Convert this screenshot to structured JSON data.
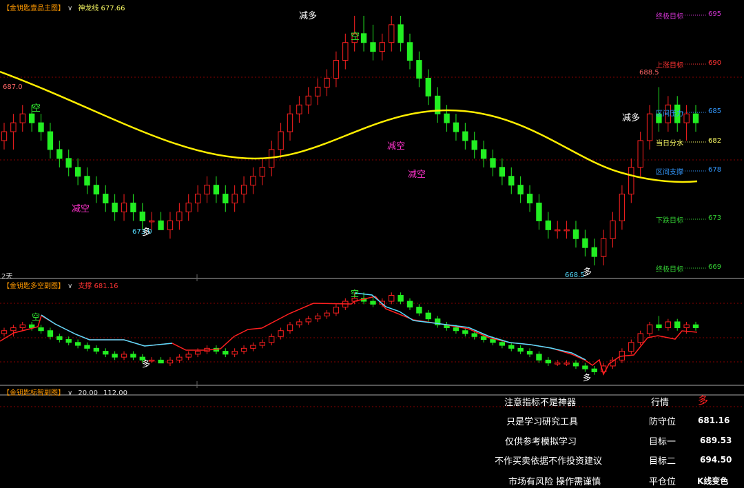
{
  "main_panel": {
    "indicator_name": "【金钥匙壹品主图】",
    "line_label": "神龙线 677.66",
    "period_label": "2天",
    "price_high_label": "687.0",
    "price_low1_label": "673.0",
    "price_low2_label": "668.5",
    "price_recent_high_label": "688.5",
    "signals": [
      "空",
      "减空",
      "多",
      "减多",
      "空",
      "减空",
      "减空",
      "多",
      "减多"
    ],
    "targets": [
      {
        "label": "终极目标",
        "value": "695",
        "color": "#cc33cc"
      },
      {
        "label": "上涨目标",
        "value": "690",
        "color": "#ff3333"
      },
      {
        "label": "区间压力",
        "value": "685",
        "color": "#3399ff"
      },
      {
        "label": "当日分水",
        "value": "682",
        "color": "#ffff66"
      },
      {
        "label": "区间支撑",
        "value": "678",
        "color": "#3399ff"
      },
      {
        "label": "下跌目标",
        "value": "673",
        "color": "#33cc33"
      },
      {
        "label": "终极目标",
        "value": "669",
        "color": "#33cc33"
      }
    ]
  },
  "sub_panel1": {
    "indicator_name": "【金钥匙多空副图】",
    "support_label": "支撑 681.16",
    "signals": [
      "空",
      "多",
      "空",
      "多"
    ]
  },
  "sub_panel2": {
    "indicator_name": "【金钥匙标智副图】",
    "val1": "20.00",
    "val2": "112.00"
  },
  "info": {
    "lines": [
      "注意指标不是神器",
      "只是学习研究工具",
      "仅供参考模拟学习",
      "不作买卖依据不作投资建议",
      "市场有风险 操作需谨慎"
    ],
    "rows": [
      {
        "label": "行情",
        "value": "多"
      },
      {
        "label": "防守位",
        "value": "681.16"
      },
      {
        "label": "目标一",
        "value": "689.53"
      },
      {
        "label": "目标二",
        "value": "694.50"
      },
      {
        "label": "平仓位",
        "value": "K线变色"
      }
    ]
  },
  "chart_data": {
    "type": "candlestick",
    "ylim": [
      667,
      697
    ],
    "candles": [
      [
        682,
        684,
        681,
        683
      ],
      [
        683,
        685,
        681,
        684
      ],
      [
        684,
        686,
        683,
        685
      ],
      [
        685,
        686,
        683,
        684
      ],
      [
        684,
        685,
        682,
        683
      ],
      [
        683,
        684,
        680,
        681
      ],
      [
        681,
        682,
        679,
        680
      ],
      [
        680,
        681,
        678,
        679
      ],
      [
        679,
        680,
        677,
        678
      ],
      [
        678,
        679,
        676,
        677
      ],
      [
        677,
        678,
        675,
        676
      ],
      [
        676,
        677,
        674,
        675
      ],
      [
        675,
        676,
        673,
        674
      ],
      [
        674,
        676,
        673,
        675
      ],
      [
        675,
        676,
        673,
        674
      ],
      [
        674,
        675,
        672,
        673
      ],
      [
        673,
        674,
        672,
        673
      ],
      [
        673,
        674,
        672,
        672
      ],
      [
        672,
        674,
        671,
        673
      ],
      [
        673,
        675,
        672,
        674
      ],
      [
        674,
        676,
        673,
        675
      ],
      [
        675,
        677,
        674,
        676
      ],
      [
        676,
        678,
        675,
        677
      ],
      [
        677,
        678,
        675,
        676
      ],
      [
        676,
        677,
        674,
        675
      ],
      [
        675,
        677,
        674,
        676
      ],
      [
        676,
        678,
        675,
        677
      ],
      [
        677,
        679,
        676,
        678
      ],
      [
        678,
        680,
        677,
        679
      ],
      [
        679,
        682,
        678,
        681
      ],
      [
        681,
        684,
        680,
        683
      ],
      [
        683,
        686,
        682,
        685
      ],
      [
        685,
        687,
        684,
        686
      ],
      [
        686,
        688,
        685,
        687
      ],
      [
        687,
        689,
        686,
        688
      ],
      [
        688,
        690,
        687,
        689
      ],
      [
        689,
        692,
        688,
        691
      ],
      [
        691,
        694,
        690,
        693
      ],
      [
        693,
        696,
        692,
        694
      ],
      [
        694,
        696,
        692,
        693
      ],
      [
        693,
        695,
        691,
        692
      ],
      [
        692,
        694,
        691,
        693
      ],
      [
        693,
        696,
        692,
        695
      ],
      [
        695,
        696,
        692,
        693
      ],
      [
        693,
        694,
        690,
        691
      ],
      [
        691,
        692,
        688,
        689
      ],
      [
        689,
        690,
        686,
        687
      ],
      [
        687,
        688,
        684,
        685
      ],
      [
        685,
        686,
        683,
        684
      ],
      [
        684,
        685,
        682,
        683
      ],
      [
        683,
        684,
        681,
        682
      ],
      [
        682,
        683,
        680,
        681
      ],
      [
        681,
        682,
        679,
        680
      ],
      [
        680,
        681,
        678,
        679
      ],
      [
        679,
        680,
        677,
        678
      ],
      [
        678,
        679,
        676,
        677
      ],
      [
        677,
        678,
        675,
        676
      ],
      [
        676,
        677,
        674,
        675
      ],
      [
        675,
        676,
        672,
        673
      ],
      [
        673,
        674,
        671,
        672
      ],
      [
        672,
        673,
        671,
        672
      ],
      [
        672,
        673,
        671,
        672
      ],
      [
        672,
        673,
        670,
        671
      ],
      [
        671,
        672,
        669,
        670
      ],
      [
        670,
        671,
        668,
        669
      ],
      [
        669,
        672,
        668,
        671
      ],
      [
        671,
        674,
        670,
        673
      ],
      [
        673,
        677,
        672,
        676
      ],
      [
        676,
        680,
        675,
        679
      ],
      [
        679,
        683,
        678,
        682
      ],
      [
        682,
        686,
        681,
        685
      ],
      [
        685,
        688,
        683,
        684
      ],
      [
        684,
        687,
        683,
        686
      ],
      [
        686,
        687,
        683,
        684
      ],
      [
        684,
        686,
        682,
        685
      ],
      [
        685,
        686,
        683,
        684
      ]
    ]
  }
}
